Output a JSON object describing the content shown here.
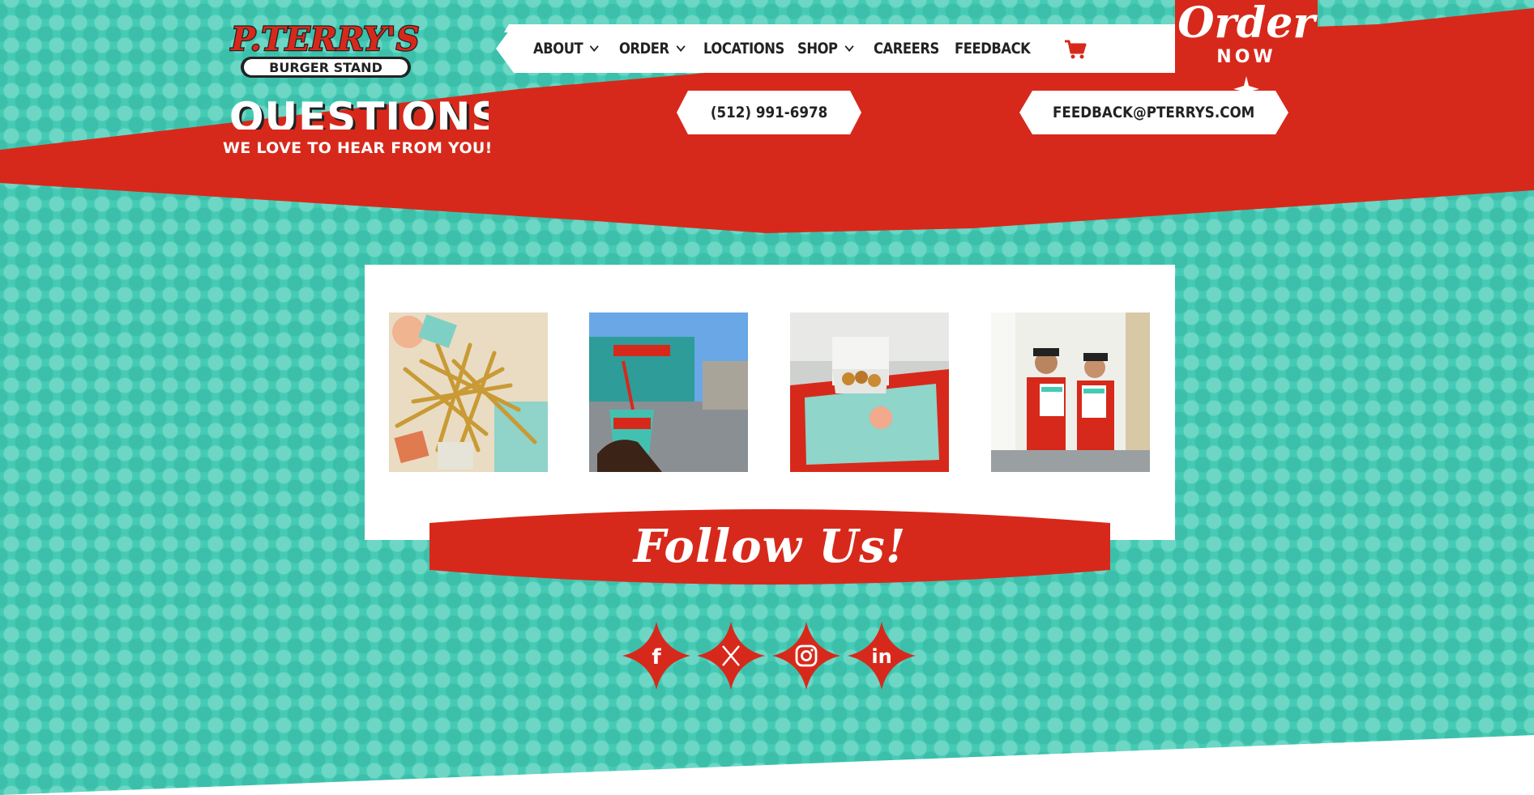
{
  "brand": {
    "name_top": "P.TERRY'S",
    "name_bottom": "BURGER STAND"
  },
  "nav": {
    "items": [
      {
        "label": "ABOUT",
        "has_dropdown": true
      },
      {
        "label": "ORDER",
        "has_dropdown": true
      },
      {
        "label": "LOCATIONS",
        "has_dropdown": false
      },
      {
        "label": "SHOP",
        "has_dropdown": true
      },
      {
        "label": "CAREERS",
        "has_dropdown": false
      },
      {
        "label": "FEEDBACK",
        "has_dropdown": false
      }
    ],
    "cart_icon": "cart-icon"
  },
  "order_badge": {
    "title": "Order",
    "subtitle": "NOW"
  },
  "contact": {
    "heading": "QUESTIONS",
    "subheading": "WE LOVE TO HEAR FROM YOU!",
    "phone": "(512) 991-6978",
    "email": "FEEDBACK@PTERRYS.COM"
  },
  "gallery": {
    "photos": [
      "fries-photo",
      "drink-cup-photo",
      "tray-bites-photo",
      "staff-window-photo"
    ]
  },
  "follow": {
    "label": "Follow Us!"
  },
  "social": [
    {
      "name": "facebook-icon",
      "glyph": "f"
    },
    {
      "name": "x-icon",
      "glyph": "𝕏"
    },
    {
      "name": "instagram-icon",
      "glyph": ""
    },
    {
      "name": "linkedin-icon",
      "glyph": "in"
    }
  ],
  "colors": {
    "teal": "#45cbb5",
    "red": "#d7291b",
    "white": "#ffffff",
    "dark": "#222222"
  }
}
